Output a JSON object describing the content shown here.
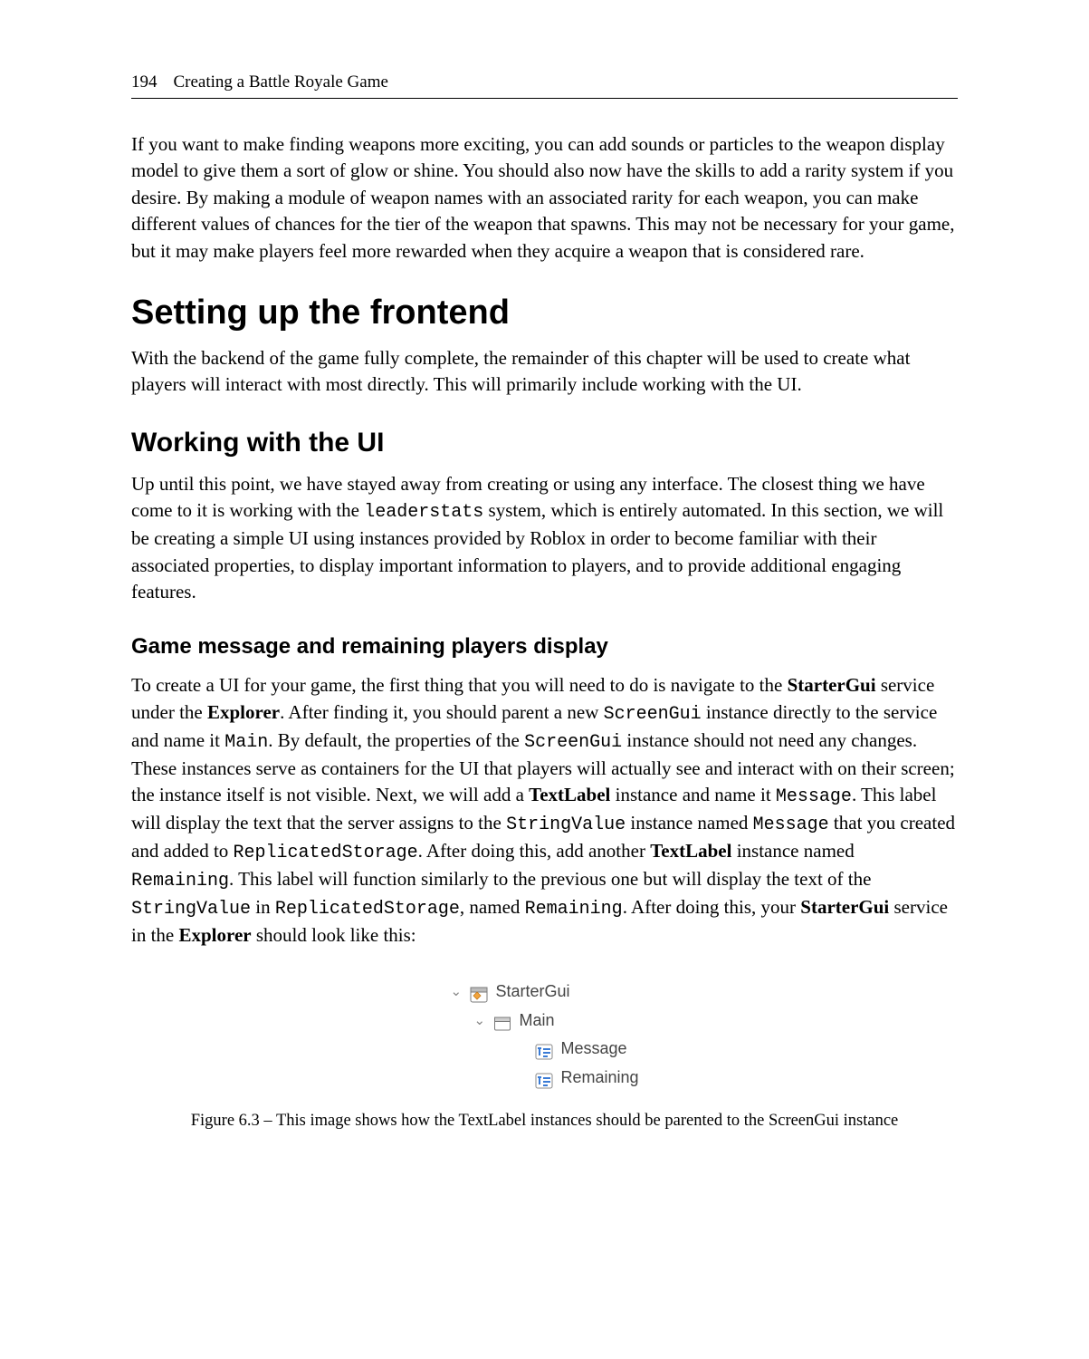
{
  "header": {
    "page_number": "194",
    "chapter_title": "Creating a Battle Royale Game"
  },
  "paragraphs": {
    "intro": "If you want to make finding weapons more exciting, you can add sounds or particles to the weapon display model to give them a sort of glow or shine. You should also now have the skills to add a rarity system if you desire. By making a module of weapon names with an associated rarity for each weapon, you can make different values of chances for the tier of the weapon that spawns. This may not be necessary for your game, but it may make players feel more rewarded when they acquire a weapon that is considered rare.",
    "section_heading": "Setting up the frontend",
    "section_intro": "With the backend of the game fully complete, the remainder of this chapter will be used to create what players will interact with most directly. This will primarily include working with the UI.",
    "subheading": "Working with the UI",
    "ui_p_pre": "Up until this point, we have stayed away from creating or using any interface. The closest thing we have come to it is working with the ",
    "ui_p_code1": "leaderstats",
    "ui_p_post": " system, which is entirely automated. In this section, we will be creating a simple UI using instances provided by Roblox in order to become familiar with their associated properties, to display important information to players, and to provide additional engaging features.",
    "subsubheading": "Game message and remaining players display",
    "msg": {
      "t1": "To create a UI for your game, the first thing that you will need to do is navigate to the ",
      "b1": "StarterGui",
      "t2": " service under the ",
      "b2": "Explorer",
      "t3": ". After finding it, you should parent a new ",
      "c1": "ScreenGui",
      "t4": " instance directly to the service and name it ",
      "c2": "Main",
      "t5": ". By default, the properties of the ",
      "c3": "ScreenGui",
      "t6": " instance should not need any changes. These instances serve as containers for the UI that players will actually see and interact with on their screen; the instance itself is not visible. Next, we will add a ",
      "b3": "TextLabel",
      "t7": " instance and name it ",
      "c4": "Message",
      "t8": ". This label will display the text that the server assigns to the ",
      "c5": "StringValue",
      "t9": " instance named ",
      "c6": "Message",
      "t10": " that you created and added to ",
      "c7": "ReplicatedStorage",
      "t11": ". After doing this, add another ",
      "b4": "TextLabel",
      "t12": " instance named ",
      "c8": "Remaining",
      "t13": ". This label will function similarly to the previous one but will display the text of the ",
      "c9": "StringValue",
      "t14": " in ",
      "c10": "ReplicatedStorage",
      "t15": ", named ",
      "c11": "Remaining",
      "t16": ". After doing this, your ",
      "b5": "StarterGui",
      "t17": " service in the ",
      "b6": "Explorer",
      "t18": " should look like this:"
    }
  },
  "tree": {
    "items": [
      {
        "label": "StarterGui",
        "icon": "startergui-icon",
        "depth": 0,
        "expandable": true
      },
      {
        "label": "Main",
        "icon": "screengui-icon",
        "depth": 1,
        "expandable": true
      },
      {
        "label": "Message",
        "icon": "textlabel-icon",
        "depth": 2,
        "expandable": false
      },
      {
        "label": "Remaining",
        "icon": "textlabel-icon",
        "depth": 2,
        "expandable": false
      }
    ]
  },
  "figure_caption": "Figure 6.3 – This image shows how the TextLabel instances should be parented to the ScreenGui instance"
}
